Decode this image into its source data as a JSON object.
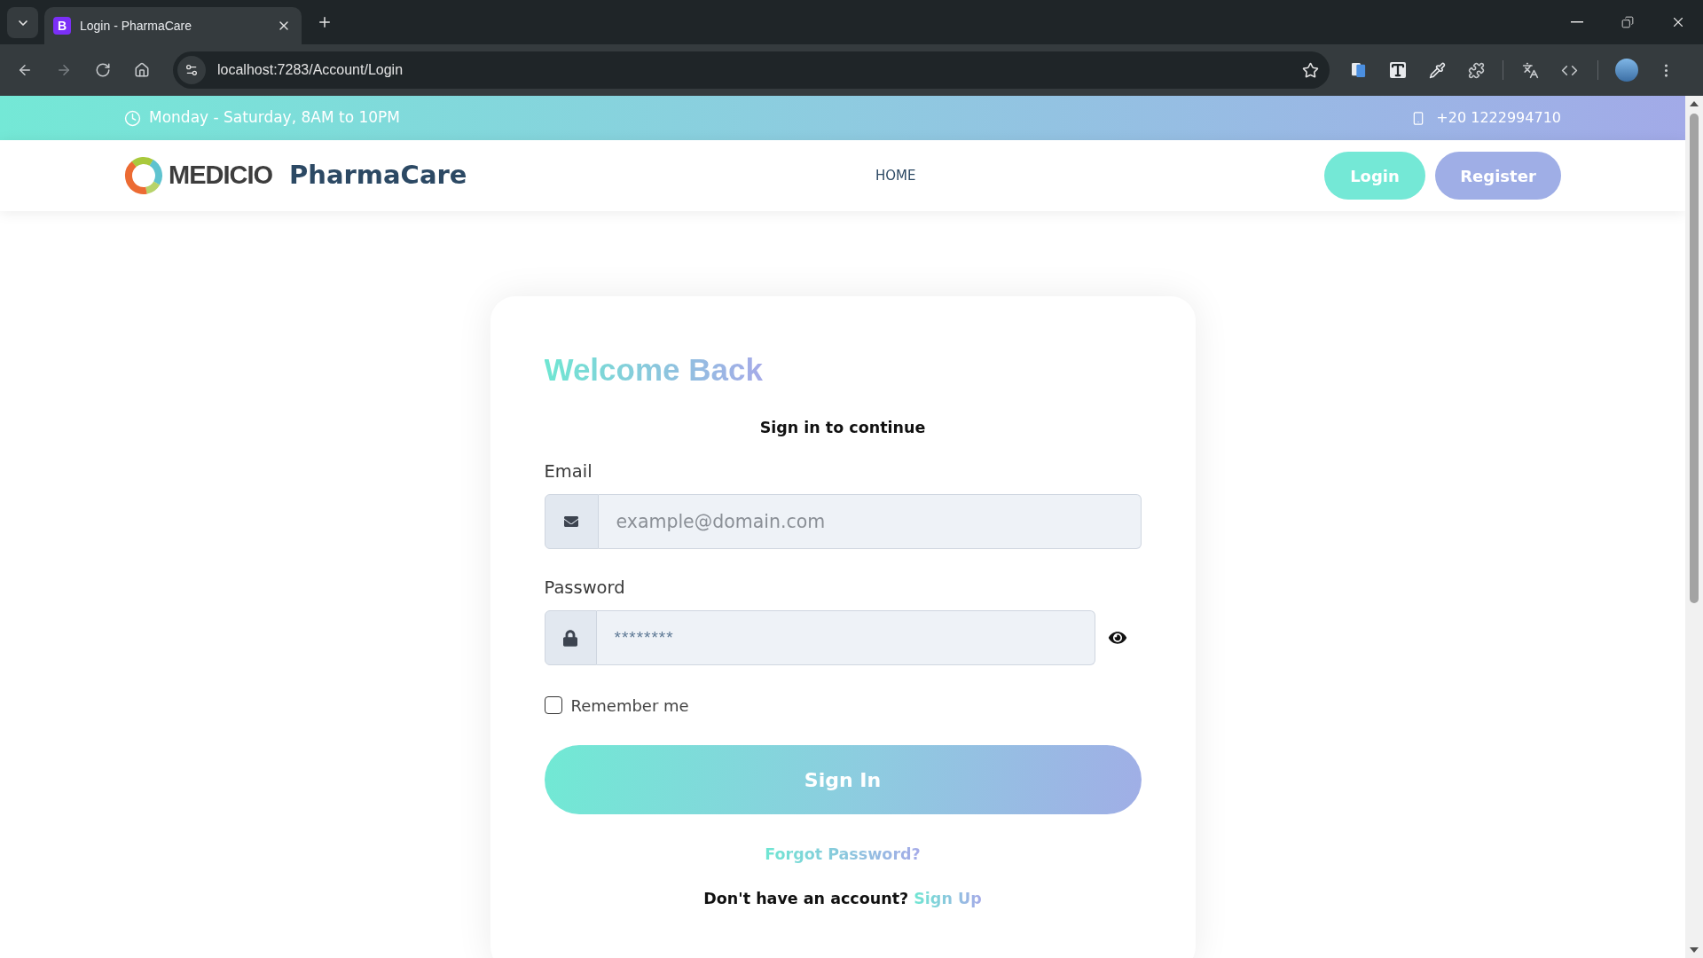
{
  "browser": {
    "tabs": [
      {
        "favicon": "B",
        "title": "Login - PharmaCare",
        "selected": true
      }
    ],
    "address": "localhost:7283/Account/Login"
  },
  "topbar": {
    "hours": "Monday - Saturday, 8AM to 10PM",
    "phone": "+20 1222994710"
  },
  "header": {
    "logo": "MEDICIO",
    "brand": "PharmaCare",
    "nav": [
      "HOME"
    ],
    "buttons": [
      {
        "label": "Login",
        "kind": "primary"
      },
      {
        "label": "Register",
        "kind": "secondary"
      }
    ]
  },
  "login": {
    "title": "Welcome Back",
    "subtitle": "Sign in to continue",
    "fields": [
      {
        "kind": "email",
        "label": "Email",
        "placeholder": "example@domain.com"
      },
      {
        "kind": "password",
        "label": "Password",
        "placeholder": "********"
      }
    ],
    "remember": {
      "label": "Remember me",
      "checked": false
    },
    "submit": "Sign In",
    "forgot": "Forgot Password?",
    "signup": {
      "prompt": "Don't have an account?",
      "link": "Sign Up"
    }
  }
}
